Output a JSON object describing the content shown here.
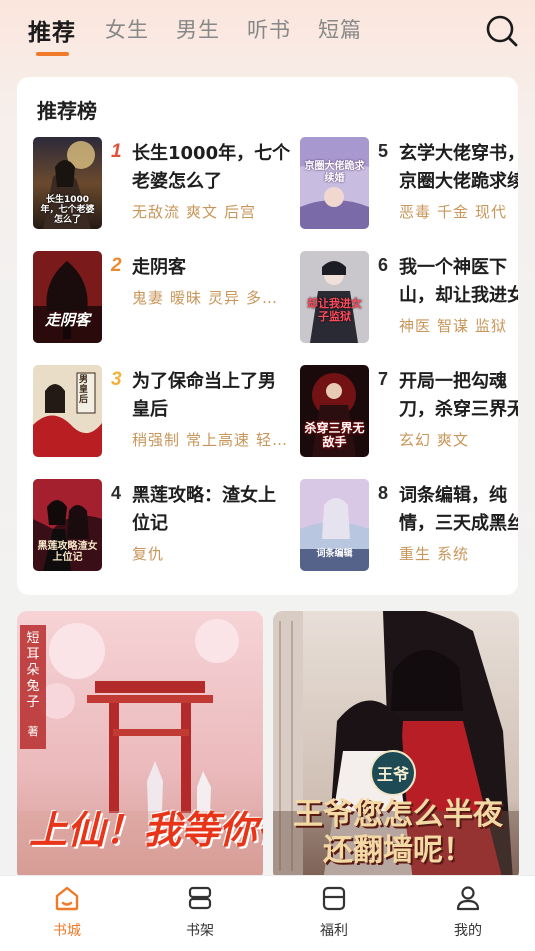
{
  "top_tabs": [
    {
      "label": "推荐",
      "active": true
    },
    {
      "label": "女生",
      "active": false
    },
    {
      "label": "男生",
      "active": false
    },
    {
      "label": "听书",
      "active": false
    },
    {
      "label": "短篇",
      "active": false
    }
  ],
  "search_icon": "search-icon",
  "ranking": {
    "title": "推荐榜",
    "items": [
      {
        "rank": "1",
        "title": "长生1000年，七个老婆怎么了",
        "tags": [
          "无敌流",
          "爽文",
          "后宫"
        ],
        "cover_text": "长生1000年，七个老婆怎么了"
      },
      {
        "rank": "2",
        "title": "走阴客",
        "tags": [
          "鬼妻",
          "暧昧",
          "灵异",
          "多…"
        ],
        "cover_text": "走阴客"
      },
      {
        "rank": "3",
        "title": "为了保命当上了男皇后",
        "tags": [
          "稍强制",
          "常上高速",
          "轻…"
        ],
        "cover_text": "男皇后"
      },
      {
        "rank": "4",
        "title": "黑莲攻略：渣女上位记",
        "tags": [
          "复仇"
        ],
        "cover_text": "黑莲攻略渣女上位记"
      },
      {
        "rank": "5",
        "title": "玄学大佬穿书，京圈大佬跪求续婚",
        "tags": [
          "恶毒",
          "千金",
          "现代"
        ],
        "cover_text": "京圈大佬跪求续婚"
      },
      {
        "rank": "6",
        "title": "我一个神医下山，却让我进女子监狱",
        "tags": [
          "神医",
          "智谋",
          "监狱"
        ],
        "cover_text": "却让我进女子监狱"
      },
      {
        "rank": "7",
        "title": "开局一把勾魂刀，杀穿三界无敌手",
        "tags": [
          "玄幻",
          "爽文"
        ],
        "cover_text": "杀穿三界无敌手"
      },
      {
        "rank": "8",
        "title": "词条编辑，纯情，三天成黑丝御姐",
        "tags": [
          "重生",
          "系统"
        ],
        "cover_text": "词条编辑"
      }
    ]
  },
  "banners": [
    {
      "title": "上仙！我等你很久了",
      "author": "短耳朵兔子",
      "author_suffix": "著"
    },
    {
      "title": "王爷您怎么半夜还翻墙呢！",
      "badge": "王爷"
    }
  ],
  "bottom_nav": [
    {
      "label": "书城",
      "icon": "home-icon",
      "active": true
    },
    {
      "label": "书架",
      "icon": "bookshelf-icon",
      "active": false
    },
    {
      "label": "福利",
      "icon": "gift-icon",
      "active": false
    },
    {
      "label": "我的",
      "icon": "user-icon",
      "active": false
    }
  ],
  "colors": {
    "accent": "#f07a2a",
    "tag": "#c9965a",
    "rank1": "#e0513a",
    "rank2": "#eb8a2e",
    "rank3": "#efb13b"
  }
}
